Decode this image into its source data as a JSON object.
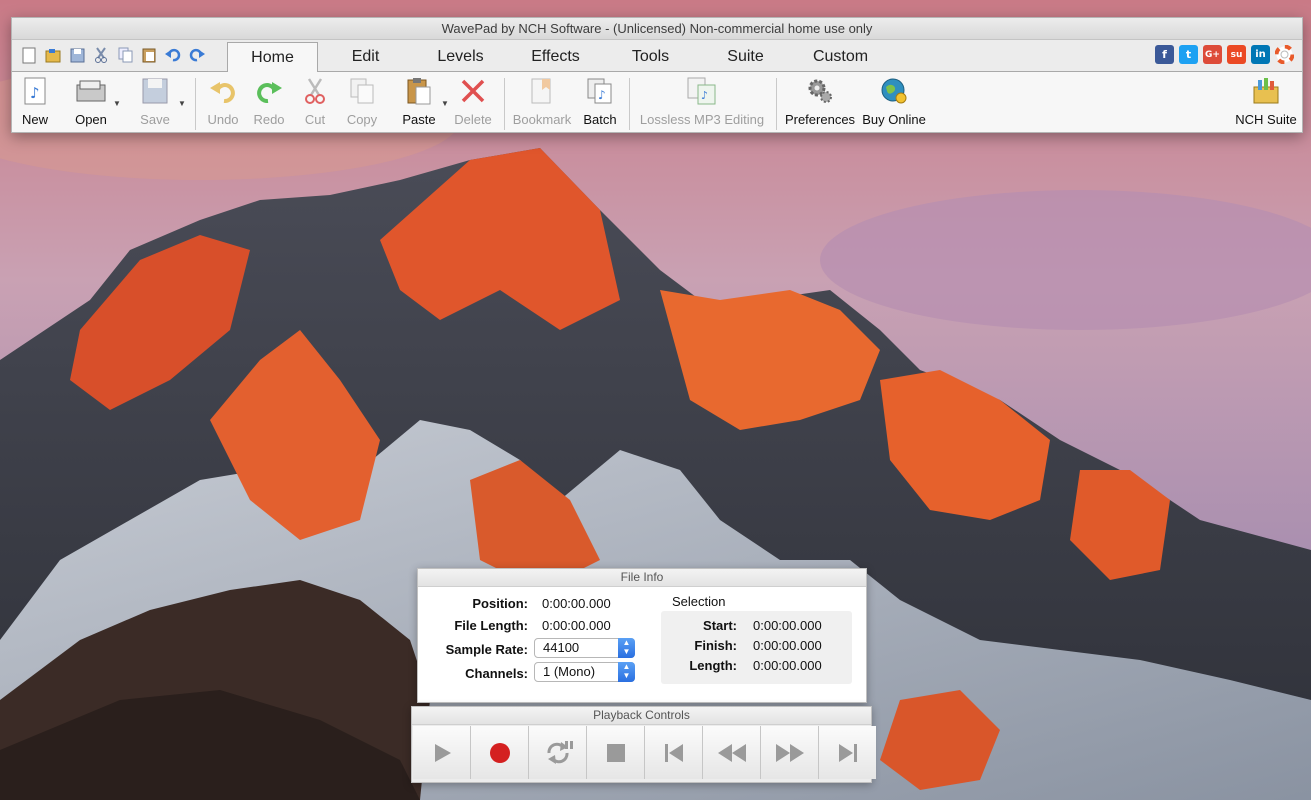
{
  "window": {
    "title": "WavePad by NCH Software - (Unlicensed) Non-commercial home use only"
  },
  "quick_access": [
    {
      "icon": "new-document-icon"
    },
    {
      "icon": "open-folder-icon"
    },
    {
      "icon": "save-disk-icon"
    },
    {
      "icon": "cut-scissors-icon"
    },
    {
      "icon": "copy-icon"
    },
    {
      "icon": "paste-clipboard-icon"
    },
    {
      "icon": "undo-arrow-icon"
    },
    {
      "icon": "redo-arrow-icon"
    }
  ],
  "tabs": [
    {
      "label": "Home",
      "active": true
    },
    {
      "label": "Edit"
    },
    {
      "label": "Levels"
    },
    {
      "label": "Effects"
    },
    {
      "label": "Tools"
    },
    {
      "label": "Suite"
    },
    {
      "label": "Custom"
    }
  ],
  "social": [
    {
      "icon": "facebook-icon",
      "glyph": "f",
      "color": "#3b5998"
    },
    {
      "icon": "twitter-icon",
      "glyph": "t",
      "color": "#1da1f2"
    },
    {
      "icon": "google-plus-icon",
      "glyph": "G+",
      "color": "#dd4b39"
    },
    {
      "icon": "stumbleupon-icon",
      "glyph": "su",
      "color": "#eb4924"
    },
    {
      "icon": "linkedin-icon",
      "glyph": "in",
      "color": "#0077b5"
    },
    {
      "icon": "help-lifebuoy-icon",
      "glyph": "",
      "color": "#e85a2a"
    }
  ],
  "toolbar": {
    "new": "New",
    "open": "Open",
    "save": "Save",
    "undo": "Undo",
    "redo": "Redo",
    "cut": "Cut",
    "copy": "Copy",
    "paste": "Paste",
    "delete": "Delete",
    "bookmark": "Bookmark",
    "batch": "Batch",
    "lossless": "Lossless MP3 Editing",
    "preferences": "Preferences",
    "buy_online": "Buy Online",
    "nch_suite": "NCH Suite"
  },
  "file_info": {
    "title": "File Info",
    "position_label": "Position:",
    "position": "0:00:00.000",
    "file_length_label": "File Length:",
    "file_length": "0:00:00.000",
    "sample_rate_label": "Sample Rate:",
    "sample_rate": "44100",
    "channels_label": "Channels:",
    "channels": "1 (Mono)",
    "selection": {
      "title": "Selection",
      "start_label": "Start:",
      "start": "0:00:00.000",
      "finish_label": "Finish:",
      "finish": "0:00:00.000",
      "length_label": "Length:",
      "length": "0:00:00.000"
    }
  },
  "playback": {
    "title": "Playback Controls",
    "buttons": [
      {
        "icon": "play-icon"
      },
      {
        "icon": "record-icon"
      },
      {
        "icon": "loop-icon"
      },
      {
        "icon": "stop-icon"
      },
      {
        "icon": "skip-to-start-icon"
      },
      {
        "icon": "rewind-icon"
      },
      {
        "icon": "fast-forward-icon"
      },
      {
        "icon": "skip-to-end-icon"
      }
    ]
  },
  "colors": {
    "record": "#d42020",
    "accent_blue": "#2a6fe0"
  }
}
